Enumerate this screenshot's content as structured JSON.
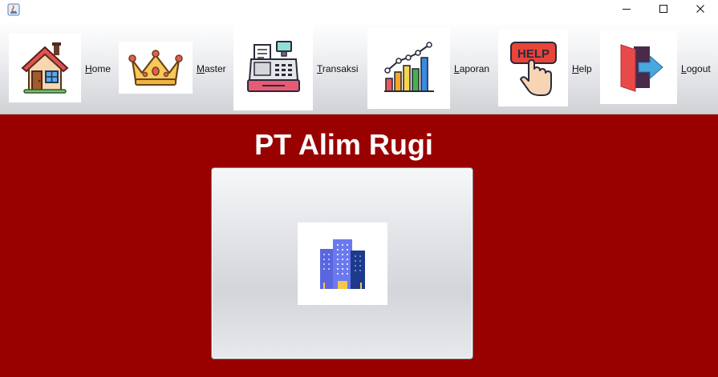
{
  "window": {
    "minimize_label": "minimize",
    "maximize_label": "maximize",
    "close_label": "close"
  },
  "menu": {
    "items": [
      {
        "label": "Home",
        "icon": "house-icon"
      },
      {
        "label": "Master",
        "icon": "crown-icon"
      },
      {
        "label": "Transaksi",
        "icon": "cash-register-icon"
      },
      {
        "label": "Laporan",
        "icon": "bar-chart-icon"
      },
      {
        "label": "Help",
        "icon": "help-hand-icon"
      },
      {
        "label": "Logout",
        "icon": "logout-door-icon"
      }
    ]
  },
  "main": {
    "company_name": "PT Alim Rugi",
    "center_button_icon": "building-icon"
  },
  "colors": {
    "main_background": "#990000",
    "title_text": "#ffffff"
  }
}
